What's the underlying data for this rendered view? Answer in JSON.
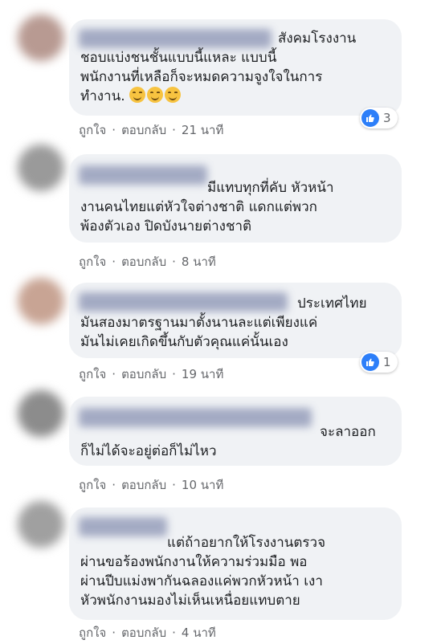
{
  "comments": [
    {
      "text_lead": "สังคมโรงงาน",
      "text_lines": [
        "ชอบแบ่งชนชั้นแบบนี้แหละ แบบนี้",
        "พนักงานที่เหลือก็จะหมดความจูงใจในการ",
        "ทำงาน."
      ],
      "emoji_count": 3,
      "like_label": "ถูกใจ",
      "reply_label": "ตอบกลับ",
      "time": "21 นาที",
      "reaction_count": "3",
      "avatar_color": "#b89a92"
    },
    {
      "text_lead": "มีแทบทุกที่คับ หัวหน้า",
      "text_lines": [
        "งานคนไทยแต่หัวใจต่างชาติ แดกแต่พวก",
        "พ้องตัวเอง ปิดบังนายต่างชาติ"
      ],
      "like_label": "ถูกใจ",
      "reply_label": "ตอบกลับ",
      "time": "8 นาที",
      "avatar_color": "#9a9a9a"
    },
    {
      "text_lead": "ประเทศไทย",
      "text_lines": [
        "มันสองมาตรฐานมาตั้งนานละแต่เพียงแค่",
        "มันไม่เคยเกิดขึ้นกับตัวคุณแค่นั้นเอง"
      ],
      "like_label": "ถูกใจ",
      "reply_label": "ตอบกลับ",
      "time": "19 นาที",
      "reaction_count": "1",
      "avatar_color": "#c8a494"
    },
    {
      "text_lead": "จะลาออก",
      "text_lines": [
        "ก็ไม่ได้จะอยู่ต่อก็ไม่ไหว"
      ],
      "like_label": "ถูกใจ",
      "reply_label": "ตอบกลับ",
      "time": "10 นาที",
      "avatar_color": "#8c8c8c"
    },
    {
      "text_lead": "แต่ถ้าอยากให้โรงงานตรวจ",
      "text_lines": [
        "ผ่านขอร้องพนักงานให้ความร่วมมือ พอ",
        "ผ่านปีบแม่งพากันฉลองแค่พวกหัวหน้า เงา",
        "หัวพนักงานมองไม่เห็นเหนื่อยแทบตาย"
      ],
      "like_label": "ถูกใจ",
      "reply_label": "ตอบกลับ",
      "time": "4 นาที",
      "avatar_color": "#a0a0a0"
    }
  ],
  "colors": {
    "bubble": "#f0f2f5",
    "meta_text": "#65676b",
    "like_blue": "#2d7ff9"
  }
}
